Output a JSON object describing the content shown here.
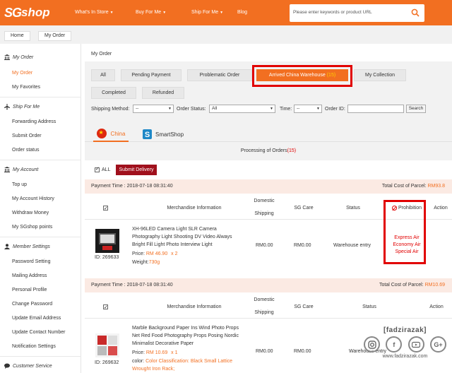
{
  "header": {
    "logo_prefix": "SG",
    "logo_suffix": "shop",
    "nav": [
      {
        "label": "What's In Store",
        "caret": true
      },
      {
        "label": "Buy For Me",
        "caret": true
      },
      {
        "label": "Ship For Me",
        "caret": true
      },
      {
        "label": "Blog",
        "caret": false
      }
    ],
    "search_placeholder": "Please enter keywords or product URL",
    "brand_color": "#f26f21"
  },
  "breadcrumb": [
    "Home",
    "My Order"
  ],
  "sidebar": {
    "sections": [
      {
        "title": "My Order",
        "icon": "bank-icon",
        "items": [
          {
            "label": "My Order",
            "active": true
          },
          {
            "label": "My Favorites",
            "active": false
          }
        ]
      },
      {
        "title": "Ship For Me",
        "icon": "plane-icon",
        "items": [
          {
            "label": "Forwarding Address"
          },
          {
            "label": "Submit Order"
          },
          {
            "label": "Order status"
          }
        ]
      },
      {
        "title": "My Account",
        "icon": "bank-icon",
        "items": [
          {
            "label": "Top up"
          },
          {
            "label": "My Account History"
          },
          {
            "label": "Withdraw Money"
          },
          {
            "label": "My SGshop points"
          }
        ]
      },
      {
        "title": "Member Settings",
        "icon": "user-icon",
        "items": [
          {
            "label": "Password Setting"
          },
          {
            "label": "Mailing Address"
          },
          {
            "label": "Personal Profile"
          },
          {
            "label": "Change Password"
          },
          {
            "label": "Update Email Address"
          },
          {
            "label": "Update Contact Number"
          },
          {
            "label": "Notification Settings"
          }
        ]
      },
      {
        "title": "Customer Service",
        "icon": "chat-icon",
        "items": []
      }
    ]
  },
  "main": {
    "title": "My Order",
    "tabs": [
      {
        "label": "All"
      },
      {
        "label": "Pending Payment"
      },
      {
        "label": "Problematic Order"
      },
      {
        "label": "Arrived China Warehouse",
        "count": "(15)",
        "active": true
      },
      {
        "label": "My Collection"
      },
      {
        "label": "Completed"
      },
      {
        "label": "Refunded"
      }
    ],
    "filters": {
      "shipping_method_label": "Shipping Method:",
      "shipping_method_value": "--",
      "order_status_label": "Order Status:",
      "order_status_value": "All",
      "time_label": "Time:",
      "time_value": "--",
      "order_id_label": "Order ID:",
      "search_button": "Search"
    },
    "country_tabs": [
      {
        "label": "China",
        "active": true,
        "icon": "china-flag-icon"
      },
      {
        "label": "SmartShop",
        "active": false,
        "icon": "smartshop-icon"
      }
    ],
    "processing_label": "Processing of Orders",
    "processing_count": "(15)",
    "all_label": "ALL",
    "submit_delivery": "Submit Delivery",
    "table_headers": {
      "merchandise": "Merchandise Information",
      "domestic": "Domestic",
      "shipping": "Shipping",
      "sg_care": "SG Care",
      "status": "Status",
      "prohibition": "Prohibition",
      "action": "Action"
    },
    "orders": [
      {
        "payment_time_label": "Payment Time :",
        "payment_time": "2018-07-18 08:31:40",
        "total_label": "Total Cost of Parcel:",
        "total": "RM93.8",
        "item_title": "XH-96LED Camera Light SLR Camera Photography Light Shooting DV Video Always Bright Fill Light Photo Interview Light",
        "price_label": "Price:",
        "price": "RM 46.90",
        "qty": "x 2",
        "weight_label": "Weight:",
        "weight": "730g",
        "id_label": "ID:",
        "id": "269633",
        "domestic_shipping": "RM0.00",
        "sg_care": "RM0.00",
        "status": "Warehouse entry",
        "prohibition": [
          "Express Air",
          "Economy Air",
          "Special Air"
        ]
      },
      {
        "payment_time_label": "Payment Time :",
        "payment_time": "2018-07-18 08:31:40",
        "total_label": "Total Cost of Parcel:",
        "total": "RM10.69",
        "item_title": "Marble Background Paper Ins Wind Photo Props Net Red Food Photography Props Posing Nordic Minimalist Decorative Paper",
        "price_label": "Price:",
        "price": "RM 10.69",
        "qty": "x 1",
        "color_label": "color:",
        "color": "Color Classification: Black Small Lattice Wrought Iron Rack;",
        "id_label": "ID:",
        "id": "269632",
        "domestic_shipping": "RM0.00",
        "sg_care": "RM0.00",
        "status": "Warehouse entry"
      }
    ]
  },
  "watermark": {
    "title": "[fadzirazak]",
    "icons": [
      "instagram-icon",
      "facebook-icon",
      "youtube-icon",
      "google-plus-icon"
    ],
    "url": "www.fadzirazak.com"
  }
}
